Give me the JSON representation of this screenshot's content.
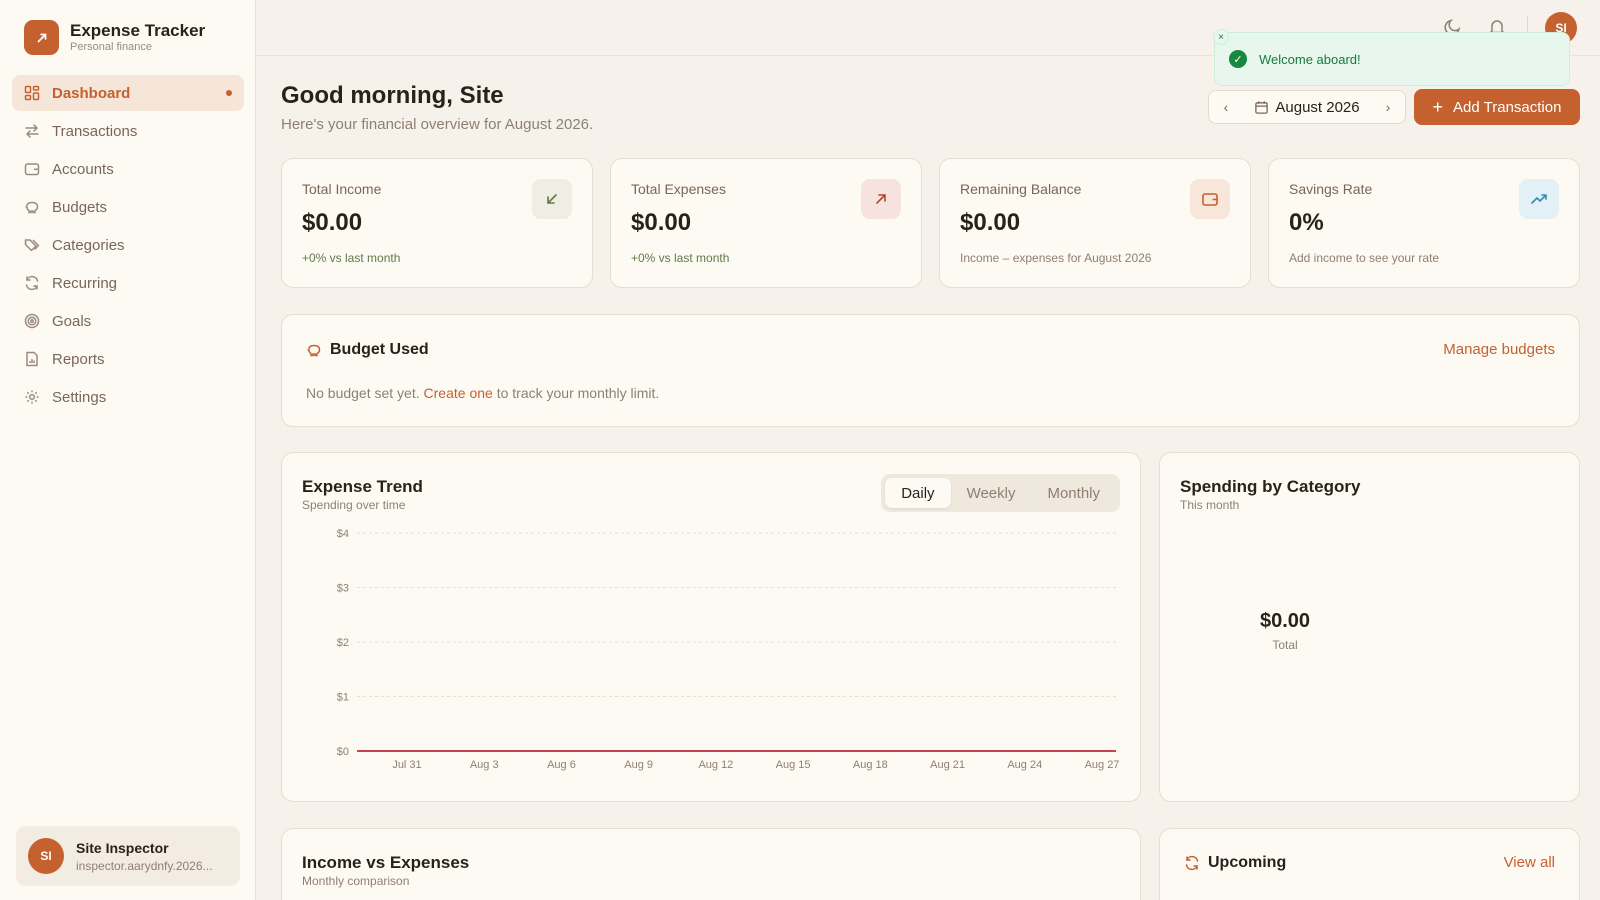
{
  "brand": {
    "title": "Expense Tracker",
    "subtitle": "Personal finance"
  },
  "nav": [
    {
      "label": "Dashboard",
      "icon": "dashboard-icon",
      "active": true
    },
    {
      "label": "Transactions",
      "icon": "transfer-icon"
    },
    {
      "label": "Accounts",
      "icon": "wallet-icon"
    },
    {
      "label": "Budgets",
      "icon": "piggy-bank-icon"
    },
    {
      "label": "Categories",
      "icon": "tags-icon"
    },
    {
      "label": "Recurring",
      "icon": "refresh-icon"
    },
    {
      "label": "Goals",
      "icon": "target-icon"
    },
    {
      "label": "Reports",
      "icon": "report-icon"
    },
    {
      "label": "Settings",
      "icon": "gear-icon"
    }
  ],
  "user": {
    "initials": "SI",
    "name": "Site Inspector",
    "email": "inspector.aarydnfy.2026..."
  },
  "toast": {
    "message": "Welcome aboard!",
    "close": "×"
  },
  "header": {
    "greeting": "Good morning, Site",
    "subtitle": "Here's your financial overview for August 2026.",
    "month": "August 2026",
    "add_button": "Add Transaction"
  },
  "stats": [
    {
      "label": "Total Income",
      "value": "$0.00",
      "note": "+0% vs last month",
      "icon": "arrow-down-left-icon"
    },
    {
      "label": "Total Expenses",
      "value": "$0.00",
      "note": "+0% vs last month",
      "icon": "arrow-up-right-icon"
    },
    {
      "label": "Remaining Balance",
      "value": "$0.00",
      "note": "Income – expenses for August 2026",
      "icon": "wallet-icon"
    },
    {
      "label": "Savings Rate",
      "value": "0%",
      "note": "Add income to see your rate",
      "icon": "trending-up-icon"
    }
  ],
  "budget": {
    "title": "Budget Used",
    "manage": "Manage budgets",
    "msg_before": "No budget set yet.",
    "msg_link": "Create one",
    "msg_after": "to track your monthly limit."
  },
  "trend": {
    "title": "Expense Trend",
    "subtitle": "Spending over time",
    "tabs": [
      "Daily",
      "Weekly",
      "Monthly"
    ],
    "active_tab": "Daily"
  },
  "category": {
    "title": "Spending by Category",
    "subtitle": "This month",
    "total": "$0.00",
    "total_label": "Total"
  },
  "income_vs": {
    "title": "Income vs Expenses",
    "subtitle": "Monthly comparison"
  },
  "upcoming": {
    "title": "Upcoming",
    "view_all": "View all"
  },
  "chart_data": {
    "type": "line",
    "title": "Expense Trend",
    "x": [
      "Jul 31",
      "Aug 3",
      "Aug 6",
      "Aug 9",
      "Aug 12",
      "Aug 15",
      "Aug 18",
      "Aug 21",
      "Aug 24",
      "Aug 27"
    ],
    "y_ticks": [
      "$0",
      "$1",
      "$2",
      "$3",
      "$4"
    ],
    "ylim": [
      0,
      4
    ],
    "series": [
      {
        "values": [
          0,
          0,
          0,
          0,
          0,
          0,
          0,
          0,
          0,
          0
        ]
      }
    ],
    "grid": true,
    "colors": {
      "line": "#c8414f"
    }
  }
}
